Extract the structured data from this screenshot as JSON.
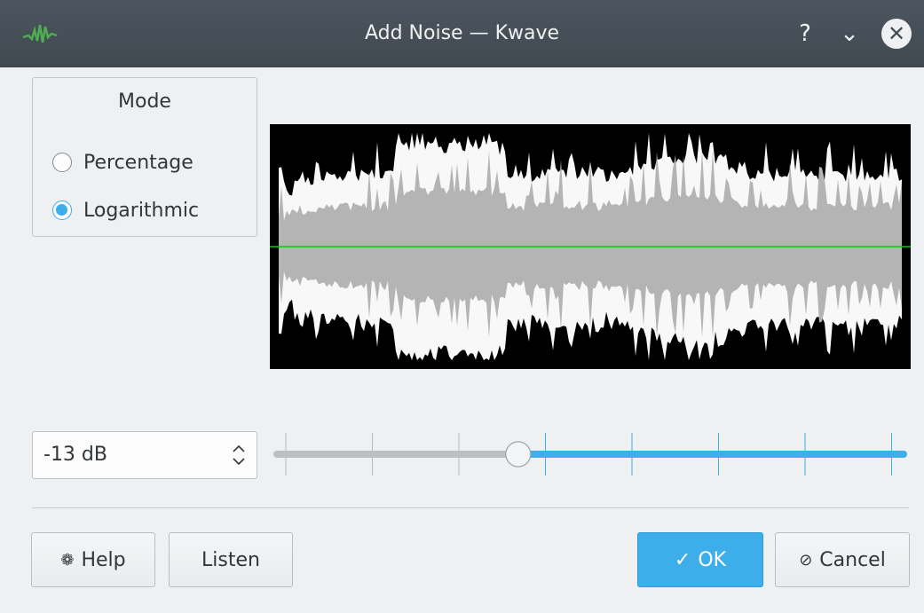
{
  "window": {
    "title": "Add Noise — Kwave",
    "help_glyph": "?",
    "minimize_glyph": "⌄",
    "close_glyph": "✕"
  },
  "mode": {
    "title": "Mode",
    "options": [
      {
        "label": "Percentage",
        "checked": false
      },
      {
        "label": "Logarithmic",
        "checked": true
      }
    ]
  },
  "level": {
    "value": "-13 dB",
    "slider_fraction": 0.385
  },
  "buttons": {
    "help": "Help",
    "listen": "Listen",
    "ok": "OK",
    "cancel": "Cancel"
  },
  "icons": {
    "app": "kwave-waveform-icon",
    "help": "help-lifebuoy-icon",
    "ok": "check-icon",
    "cancel": "cancel-circle-icon"
  },
  "colors": {
    "accent": "#3daee9",
    "signal_line": "#00d000",
    "wave_outer": "#f8f8f8",
    "wave_inner": "#b4b4b4"
  }
}
